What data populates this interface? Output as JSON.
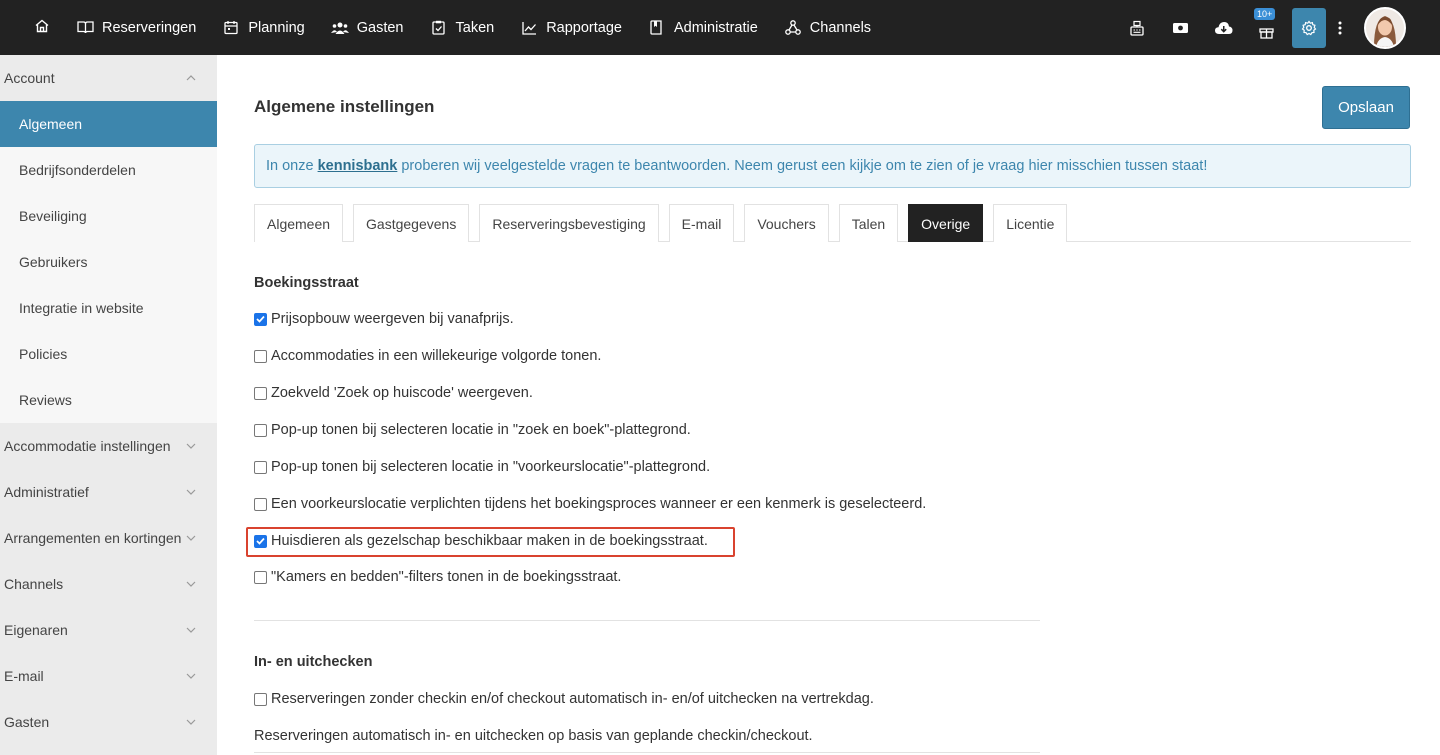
{
  "nav": {
    "home_icon": "home-icon",
    "items": [
      {
        "label": "Reserveringen",
        "icon": "book-icon"
      },
      {
        "label": "Planning",
        "icon": "calendar-icon"
      },
      {
        "label": "Gasten",
        "icon": "users-icon"
      },
      {
        "label": "Taken",
        "icon": "clipboard-icon"
      },
      {
        "label": "Rapportage",
        "icon": "chart-line-icon"
      },
      {
        "label": "Administratie",
        "icon": "ledger-icon"
      },
      {
        "label": "Channels",
        "icon": "channels-icon"
      }
    ],
    "right": {
      "icons": [
        "cash-register-icon",
        "money-icon",
        "cloud-download-icon",
        "gift-icon",
        "gear-icon",
        "kebab-menu-icon"
      ],
      "badge": "10+"
    }
  },
  "sidebar": {
    "sections": [
      {
        "label": "Account",
        "expanded": true
      },
      {
        "label": "Accommodatie instellingen"
      },
      {
        "label": "Administratief"
      },
      {
        "label": "Arrangementen en kortingen"
      },
      {
        "label": "Channels"
      },
      {
        "label": "Eigenaren"
      },
      {
        "label": "E-mail"
      },
      {
        "label": "Gasten"
      }
    ],
    "account_items": [
      {
        "label": "Algemeen",
        "active": true
      },
      {
        "label": "Bedrijfsonderdelen"
      },
      {
        "label": "Beveiliging"
      },
      {
        "label": "Gebruikers"
      },
      {
        "label": "Integratie in website"
      },
      {
        "label": "Policies"
      },
      {
        "label": "Reviews"
      }
    ]
  },
  "main": {
    "title": "Algemene instellingen",
    "save_label": "Opslaan",
    "info": {
      "prefix": "In onze",
      "link": "kennisbank",
      "suffix": "proberen wij veelgestelde vragen te beantwoorden. Neem gerust een kijkje om te zien of je vraag hier misschien tussen staat!"
    },
    "tabs": [
      {
        "label": "Algemeen"
      },
      {
        "label": "Gastgegevens"
      },
      {
        "label": "Reserveringsbevestiging"
      },
      {
        "label": "E-mail"
      },
      {
        "label": "Vouchers"
      },
      {
        "label": "Talen"
      },
      {
        "label": "Overige",
        "active": true
      },
      {
        "label": "Licentie"
      }
    ],
    "boekingsstraat": {
      "title": "Boekingsstraat",
      "options": [
        {
          "label": "Prijsopbouw weergeven bij vanafprijs.",
          "checked": true
        },
        {
          "label": "Accommodaties in een willekeurige volgorde tonen.",
          "checked": false
        },
        {
          "label": "Zoekveld 'Zoek op huiscode' weergeven.",
          "checked": false
        },
        {
          "label": "Pop-up tonen bij selecteren locatie in \"zoek en boek\"-plattegrond.",
          "checked": false
        },
        {
          "label": "Pop-up tonen bij selecteren locatie in \"voorkeurslocatie\"-plattegrond.",
          "checked": false
        },
        {
          "label": "Een voorkeurslocatie verplichten tijdens het boekingsproces wanneer er een kenmerk is geselecteerd.",
          "checked": false
        },
        {
          "label": "Huisdieren als gezelschap beschikbaar maken in de boekingsstraat.",
          "checked": true,
          "highlighted": true
        },
        {
          "label": "\"Kamers en bedden\"-filters tonen in de boekingsstraat.",
          "checked": false
        }
      ]
    },
    "checkin": {
      "title": "In- en uitchecken",
      "options": [
        {
          "label": "Reserveringen zonder checkin en/of checkout automatisch in- en/of uitchecken na vertrekdag.",
          "checked": false
        }
      ],
      "note": "Reserveringen automatisch in- en uitchecken op basis van geplande checkin/checkout."
    }
  },
  "colors": {
    "topbar": "#222222",
    "accent": "#3d86ad",
    "sidebar_bg": "#ebebeb",
    "highlight": "#d9432f",
    "checkbox": "#1a73e8"
  }
}
